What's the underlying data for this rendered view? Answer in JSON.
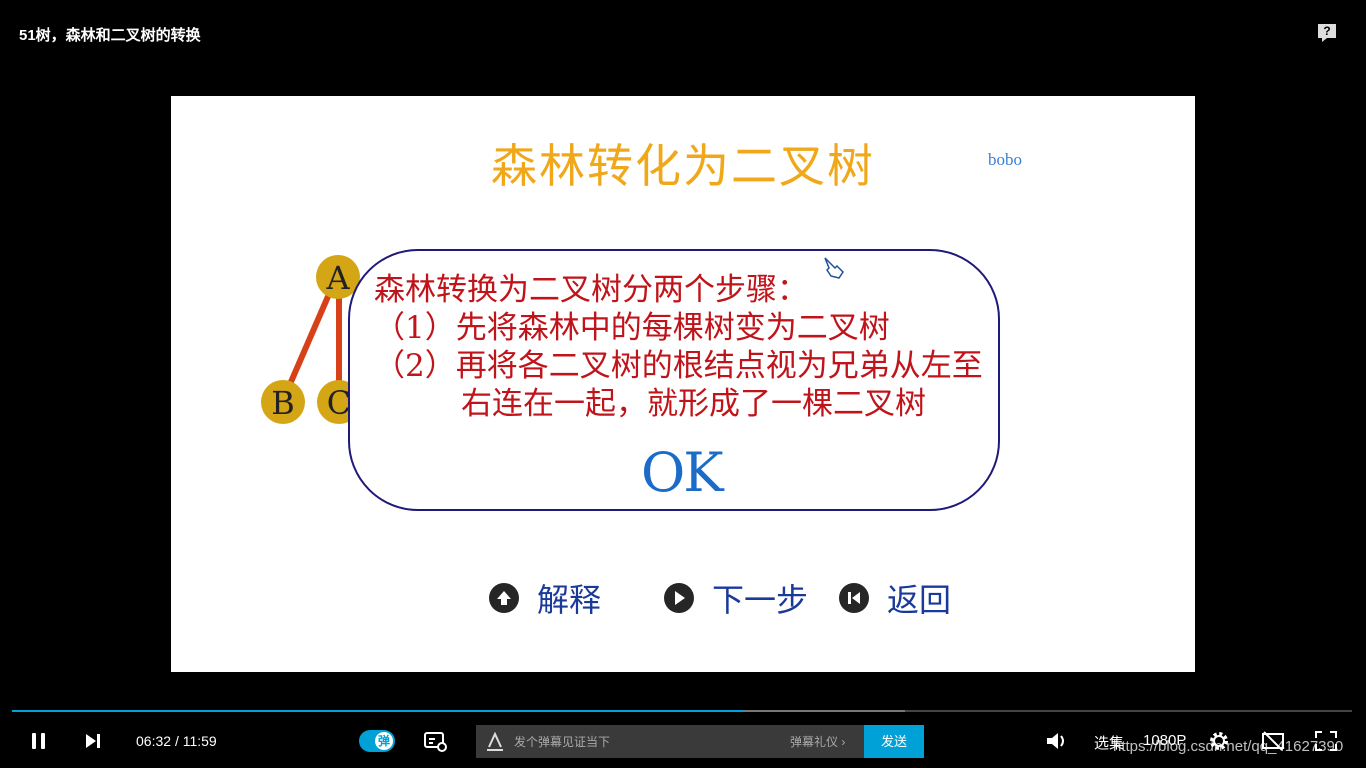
{
  "header": {
    "title": "51树，森林和二叉树的转换"
  },
  "slide": {
    "title": "森林转化为二叉树",
    "author": "bobo",
    "tree": {
      "nodes": [
        "A",
        "B",
        "C"
      ]
    },
    "bubble": {
      "line1": "森林转换为二叉树分两个步骤：",
      "line2": "（1）先将森林中的每棵树变为二叉树",
      "line3": "（2）再将各二叉树的根结点视为兄弟从左至右连在一起，就形成了一棵二叉树",
      "ok": "OK"
    },
    "nav": {
      "explain": "解释",
      "next": "下一步",
      "back": "返回"
    }
  },
  "player": {
    "current_time": "06:32",
    "separator": "/",
    "total_time": "11:59",
    "progress": 0.545,
    "buffered": 0.667,
    "danmaku_toggle": "弹",
    "danmaku_placeholder": "发个弹幕见证当下",
    "danmaku_etiquette": "弹幕礼仪 ›",
    "send_label": "发送",
    "select_episode": "选集",
    "quality": "1080P",
    "accent_color": "#00a1d6"
  },
  "watermark": "https://blog.csdn.net/qq_41627390"
}
